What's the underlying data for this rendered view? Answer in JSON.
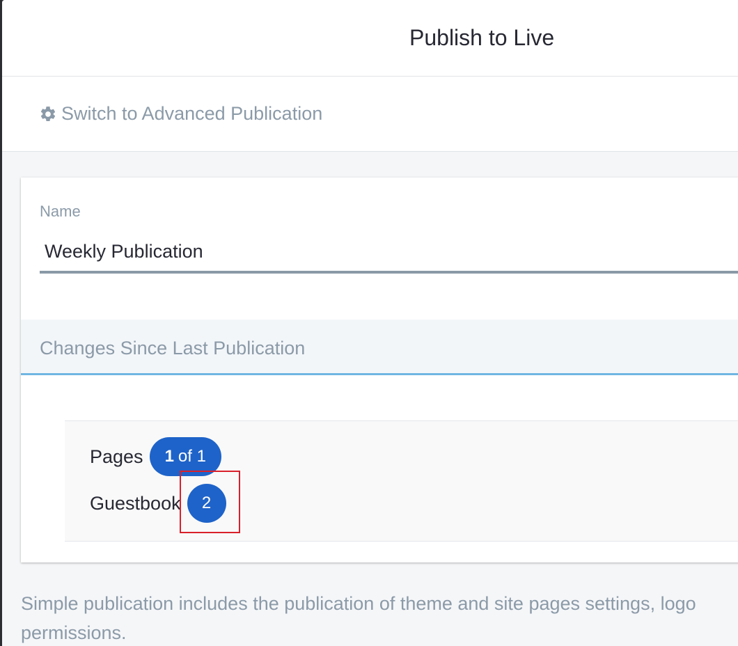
{
  "modal": {
    "title": "Publish to Live"
  },
  "switch_bar": {
    "icon": "gear-icon",
    "label": "Switch to Advanced Publication"
  },
  "name_field": {
    "label": "Name",
    "value": "Weekly Publication"
  },
  "changes": {
    "title": "Changes Since Last Publication",
    "items": [
      {
        "label": "Pages",
        "badge_bold": "1",
        "badge_rest": "of 1"
      },
      {
        "label": "Guestbook",
        "badge": "2"
      }
    ]
  },
  "footer": {
    "text": "Simple publication includes the publication of theme and site pages settings, logo permissions."
  },
  "colors": {
    "accent": "#1e63c9",
    "muted_text": "#8b9aa8",
    "tab_underline": "#6fb6e2",
    "highlight": "#d9202a"
  }
}
